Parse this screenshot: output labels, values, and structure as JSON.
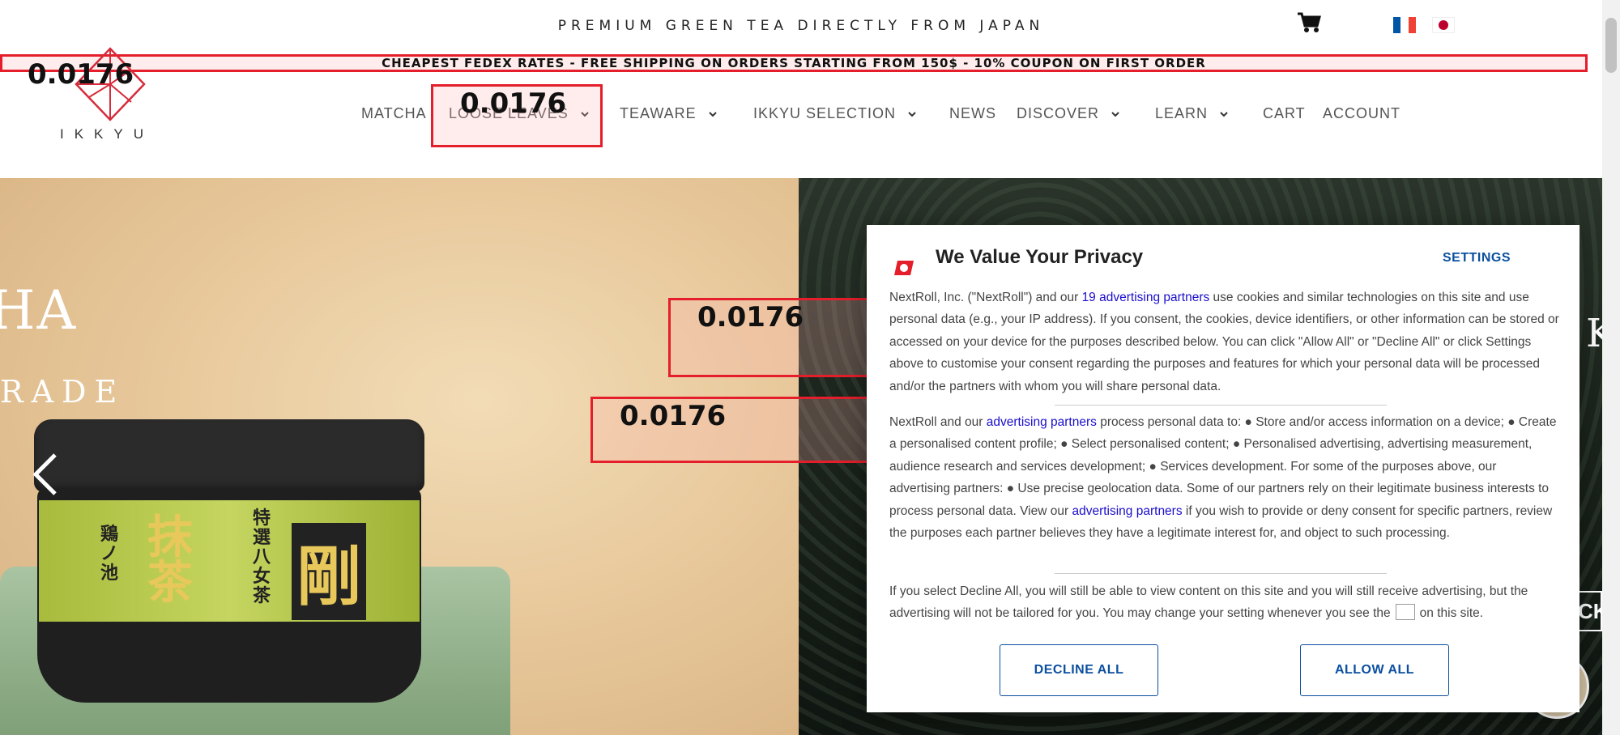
{
  "header": {
    "tagline": "PREMIUM GREEN TEA DIRECTLY FROM JAPAN",
    "cart_icon": "cart-icon",
    "languages": [
      "fr",
      "jp"
    ],
    "announcement": "CHEAPEST FEDEX RATES - FREE SHIPPING ON ORDERS STARTING FROM 150$ - 10% COUPON ON FIRST ORDER",
    "logo_text": "IKKYU",
    "nav": [
      {
        "label": "MATCHA",
        "has_dropdown": false
      },
      {
        "label": "LOOSE LEAVES",
        "has_dropdown": true
      },
      {
        "label": "TEAWARE",
        "has_dropdown": true
      },
      {
        "label": "IKKYU SELECTION",
        "has_dropdown": true
      },
      {
        "label": "NEWS",
        "has_dropdown": false
      },
      {
        "label": "DISCOVER",
        "has_dropdown": true
      },
      {
        "label": "LEARN",
        "has_dropdown": true
      },
      {
        "label": "CART",
        "has_dropdown": false
      },
      {
        "label": "ACCOUNT",
        "has_dropdown": false
      }
    ]
  },
  "overlays": {
    "label_1": "0.0176",
    "label_2": "0.0176",
    "label_3": "0.0176",
    "label_4": "0.0176"
  },
  "hero": {
    "title_partial": "HA",
    "subtitle_partial": "RADE",
    "product_kanji": {
      "main": "抹茶",
      "side": "剛",
      "brand": "鶏ノ池",
      "small": "特選八女茶"
    },
    "right_partial_button": "CK"
  },
  "privacy_modal": {
    "title": "We Value Your Privacy",
    "settings_label": "SETTINGS",
    "p1_before": "NextRoll, Inc. (\"NextRoll\") and our ",
    "p1_link": "19 advertising partners",
    "p1_after": " use cookies and similar technologies on this site and use personal data (e.g., your IP address). If you consent, the cookies, device identifiers, or other information can be stored or accessed on your device for the purposes described below. You can click \"Allow All\" or \"Decline All\" or click Settings above to customise your consent regarding the purposes and features for which your personal data will be processed and/or the partners with whom you will share personal data.",
    "p2_before": "NextRoll and our ",
    "p2_link1": "advertising partners",
    "p2_mid": " process personal data to: ● Store and/or access information on a device; ● Create a personalised content profile; ● Select personalised content; ● Personalised advertising, advertising measurement, audience research and services development; ● Services development. For some of the purposes above, our advertising partners: ● Use precise geolocation data. Some of our partners rely on their legitimate business interests to process personal data. View our ",
    "p2_link2": "advertising partners",
    "p2_after": " if you wish to provide or deny consent for specific partners, review the purposes each partner believes they have a legitimate interest for, and object to such processing.",
    "p3_before": "If you select Decline All, you will still be able to view content on this site and you will still receive advertising, but the advertising will not be tailored for you. You may change your setting whenever you see the",
    "p3_after": "on this site.",
    "decline_label": "DECLINE ALL",
    "allow_label": "ALLOW ALL"
  },
  "colors": {
    "accent_red": "#e41e2b",
    "modal_blue": "#0b4fa0",
    "link_blue": "#1a0dcc"
  }
}
